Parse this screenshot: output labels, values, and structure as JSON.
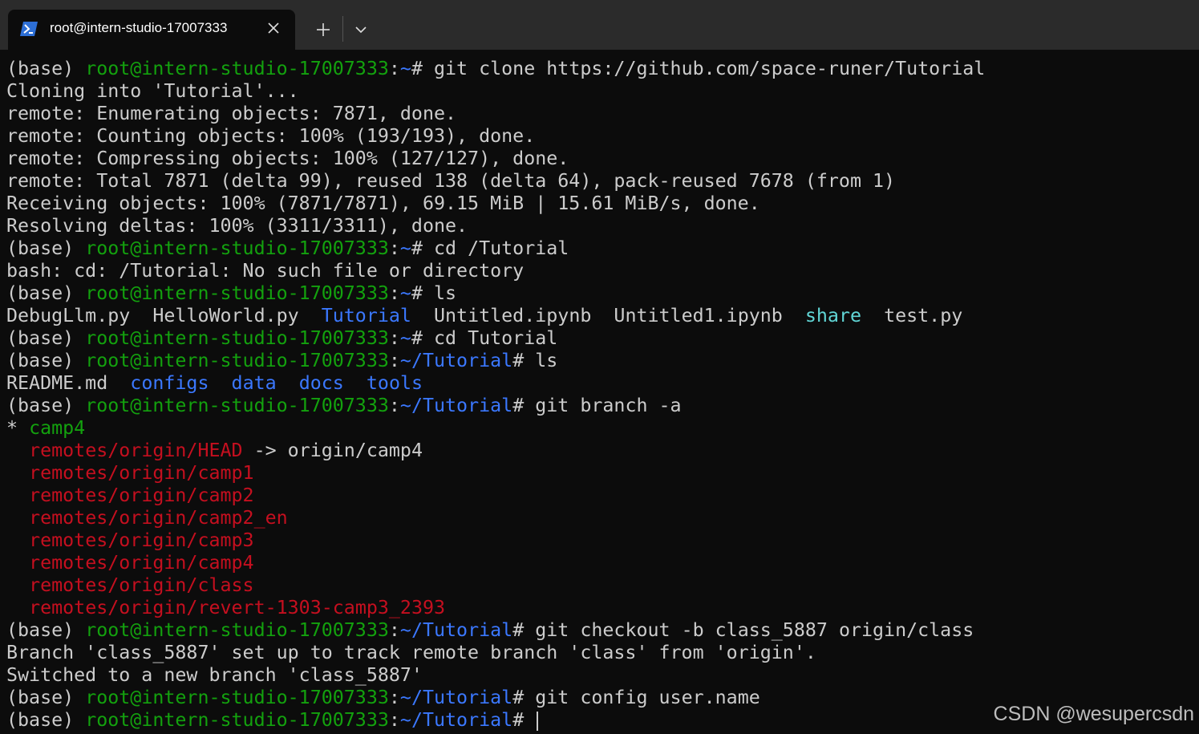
{
  "window": {
    "tab_title": "root@intern-studio-17007333",
    "tab_icon": "powershell-icon",
    "close_icon": "close-icon",
    "new_tab_icon": "plus-icon",
    "dropdown_icon": "chevron-down-icon"
  },
  "colors": {
    "background": "#0c0c0c",
    "titlebar": "#2b2b2b",
    "text": "#cccccc",
    "green": "#13a10e",
    "blue": "#3b78ff",
    "cyan": "#61d6d6",
    "red": "#c50f1f"
  },
  "terminal": {
    "lines": [
      [
        {
          "t": "(base) ",
          "c": "w"
        },
        {
          "t": "root@intern-studio-17007333",
          "c": "g"
        },
        {
          "t": ":",
          "c": "w"
        },
        {
          "t": "~",
          "c": "b"
        },
        {
          "t": "# git clone https://github.com/space-runer/Tutorial",
          "c": "w"
        }
      ],
      [
        {
          "t": "Cloning into 'Tutorial'...",
          "c": "w"
        }
      ],
      [
        {
          "t": "remote: Enumerating objects: 7871, done.",
          "c": "w"
        }
      ],
      [
        {
          "t": "remote: Counting objects: 100% (193/193), done.",
          "c": "w"
        }
      ],
      [
        {
          "t": "remote: Compressing objects: 100% (127/127), done.",
          "c": "w"
        }
      ],
      [
        {
          "t": "remote: Total 7871 (delta 99), reused 138 (delta 64), pack-reused 7678 (from 1)",
          "c": "w"
        }
      ],
      [
        {
          "t": "Receiving objects: 100% (7871/7871), 69.15 MiB | 15.61 MiB/s, done.",
          "c": "w"
        }
      ],
      [
        {
          "t": "Resolving deltas: 100% (3311/3311), done.",
          "c": "w"
        }
      ],
      [
        {
          "t": "(base) ",
          "c": "w"
        },
        {
          "t": "root@intern-studio-17007333",
          "c": "g"
        },
        {
          "t": ":",
          "c": "w"
        },
        {
          "t": "~",
          "c": "b"
        },
        {
          "t": "# cd /Tutorial",
          "c": "w"
        }
      ],
      [
        {
          "t": "bash: cd: /Tutorial: No such file or directory",
          "c": "w"
        }
      ],
      [
        {
          "t": "(base) ",
          "c": "w"
        },
        {
          "t": "root@intern-studio-17007333",
          "c": "g"
        },
        {
          "t": ":",
          "c": "w"
        },
        {
          "t": "~",
          "c": "b"
        },
        {
          "t": "# ls",
          "c": "w"
        }
      ],
      [
        {
          "t": "DebugLlm.py  HelloWorld.py  ",
          "c": "w"
        },
        {
          "t": "Tutorial",
          "c": "b"
        },
        {
          "t": "  Untitled.ipynb  Untitled1.ipynb  ",
          "c": "w"
        },
        {
          "t": "share",
          "c": "c"
        },
        {
          "t": "  test.py",
          "c": "w"
        }
      ],
      [
        {
          "t": "(base) ",
          "c": "w"
        },
        {
          "t": "root@intern-studio-17007333",
          "c": "g"
        },
        {
          "t": ":",
          "c": "w"
        },
        {
          "t": "~",
          "c": "b"
        },
        {
          "t": "# cd Tutorial",
          "c": "w"
        }
      ],
      [
        {
          "t": "(base) ",
          "c": "w"
        },
        {
          "t": "root@intern-studio-17007333",
          "c": "g"
        },
        {
          "t": ":",
          "c": "w"
        },
        {
          "t": "~/Tutorial",
          "c": "b"
        },
        {
          "t": "# ls",
          "c": "w"
        }
      ],
      [
        {
          "t": "README.md  ",
          "c": "w"
        },
        {
          "t": "configs",
          "c": "b"
        },
        {
          "t": "  ",
          "c": "w"
        },
        {
          "t": "data",
          "c": "b"
        },
        {
          "t": "  ",
          "c": "w"
        },
        {
          "t": "docs",
          "c": "b"
        },
        {
          "t": "  ",
          "c": "w"
        },
        {
          "t": "tools",
          "c": "b"
        }
      ],
      [
        {
          "t": "(base) ",
          "c": "w"
        },
        {
          "t": "root@intern-studio-17007333",
          "c": "g"
        },
        {
          "t": ":",
          "c": "w"
        },
        {
          "t": "~/Tutorial",
          "c": "b"
        },
        {
          "t": "# git branch -a",
          "c": "w"
        }
      ],
      [
        {
          "t": "* ",
          "c": "w"
        },
        {
          "t": "camp4",
          "c": "g"
        }
      ],
      [
        {
          "t": "  ",
          "c": "w"
        },
        {
          "t": "remotes/origin/HEAD",
          "c": "r"
        },
        {
          "t": " -> origin/camp4",
          "c": "w"
        }
      ],
      [
        {
          "t": "  ",
          "c": "w"
        },
        {
          "t": "remotes/origin/camp1",
          "c": "r"
        }
      ],
      [
        {
          "t": "  ",
          "c": "w"
        },
        {
          "t": "remotes/origin/camp2",
          "c": "r"
        }
      ],
      [
        {
          "t": "  ",
          "c": "w"
        },
        {
          "t": "remotes/origin/camp2_en",
          "c": "r"
        }
      ],
      [
        {
          "t": "  ",
          "c": "w"
        },
        {
          "t": "remotes/origin/camp3",
          "c": "r"
        }
      ],
      [
        {
          "t": "  ",
          "c": "w"
        },
        {
          "t": "remotes/origin/camp4",
          "c": "r"
        }
      ],
      [
        {
          "t": "  ",
          "c": "w"
        },
        {
          "t": "remotes/origin/class",
          "c": "r"
        }
      ],
      [
        {
          "t": "  ",
          "c": "w"
        },
        {
          "t": "remotes/origin/revert-1303-camp3_2393",
          "c": "r"
        }
      ],
      [
        {
          "t": "(base) ",
          "c": "w"
        },
        {
          "t": "root@intern-studio-17007333",
          "c": "g"
        },
        {
          "t": ":",
          "c": "w"
        },
        {
          "t": "~/Tutorial",
          "c": "b"
        },
        {
          "t": "# git checkout -b class_5887 origin/class",
          "c": "w"
        }
      ],
      [
        {
          "t": "Branch 'class_5887' set up to track remote branch 'class' from 'origin'.",
          "c": "w"
        }
      ],
      [
        {
          "t": "Switched to a new branch 'class_5887'",
          "c": "w"
        }
      ],
      [
        {
          "t": "(base) ",
          "c": "w"
        },
        {
          "t": "root@intern-studio-17007333",
          "c": "g"
        },
        {
          "t": ":",
          "c": "w"
        },
        {
          "t": "~/Tutorial",
          "c": "b"
        },
        {
          "t": "# git config user.name",
          "c": "w"
        }
      ],
      [
        {
          "t": "(base) ",
          "c": "w"
        },
        {
          "t": "root@intern-studio-17007333",
          "c": "g"
        },
        {
          "t": ":",
          "c": "w"
        },
        {
          "t": "~/Tutorial",
          "c": "b"
        },
        {
          "t": "# ",
          "c": "w"
        }
      ]
    ]
  },
  "watermark": "CSDN @wesupercsdn"
}
